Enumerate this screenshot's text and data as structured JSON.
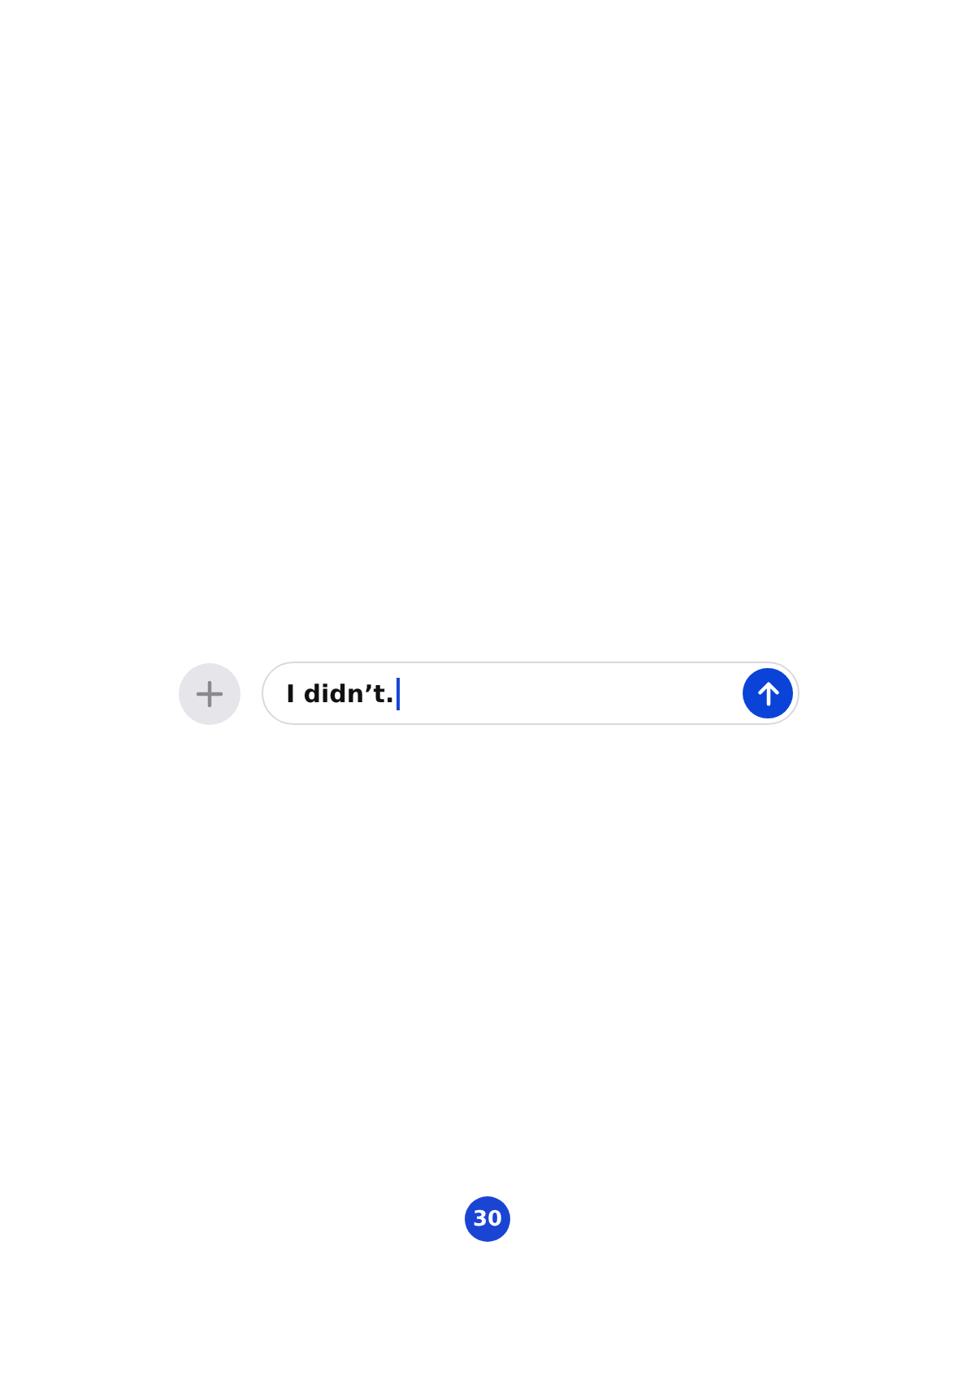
{
  "composer": {
    "value": "I didn’t.",
    "caret": true
  },
  "page_number": "30"
}
